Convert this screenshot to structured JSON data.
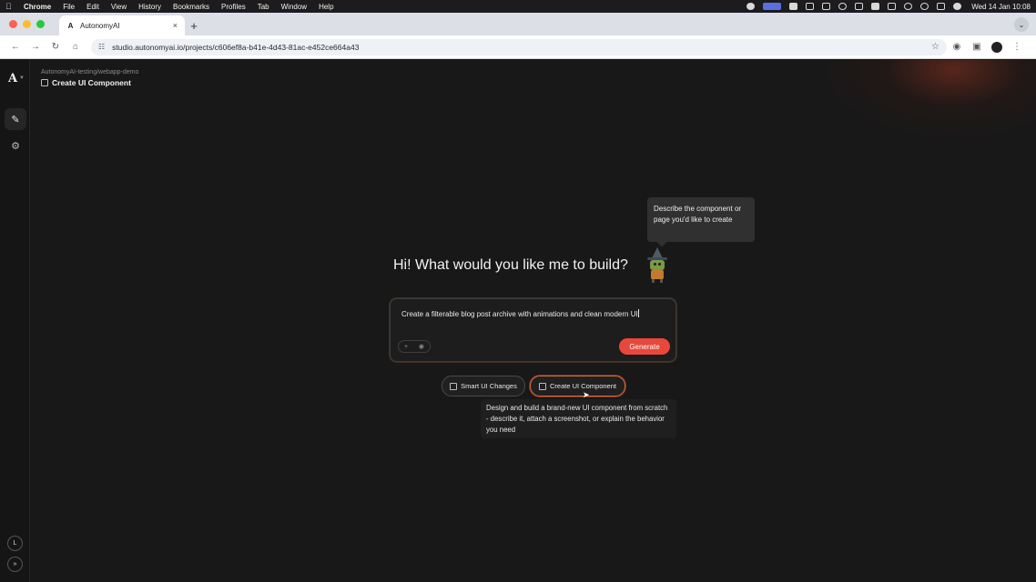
{
  "menubar": {
    "app_name": "Chrome",
    "items": [
      "File",
      "Edit",
      "View",
      "History",
      "Bookmarks",
      "Profiles",
      "Tab",
      "Window",
      "Help"
    ],
    "clock": "Wed 14 Jan  10:08"
  },
  "browser": {
    "tab_title": "AutonomyAI",
    "tab_close": "×",
    "new_tab": "+",
    "url": "studio.autonomyai.io/projects/c606ef8a-b41e-4d43-81ac-e452ce664a43",
    "traffic_colors": [
      "#ff5f57",
      "#febc2e",
      "#28c840"
    ]
  },
  "sidebar": {
    "logo": "A",
    "avatar_initial": "L"
  },
  "header": {
    "breadcrumb": "AutonomyAI-testing/webapp-demo",
    "title": "Create UI Component"
  },
  "main": {
    "greeting": "Hi! What would you like me to build?",
    "hint_bubble": "Describe the component or page you'd like to create",
    "prompt_value": "Create a filterable blog post archive with animations and clean modern UI",
    "generate_label": "Generate",
    "modes": [
      {
        "label": "Smart UI Changes",
        "selected": false
      },
      {
        "label": "Create UI Component",
        "selected": true
      }
    ],
    "mode_tooltip": "Design and build a brand-new UI component from scratch - describe it, attach a screenshot, or explain the behavior you need"
  },
  "colors": {
    "accent": "#e8473b",
    "background": "#181818"
  }
}
